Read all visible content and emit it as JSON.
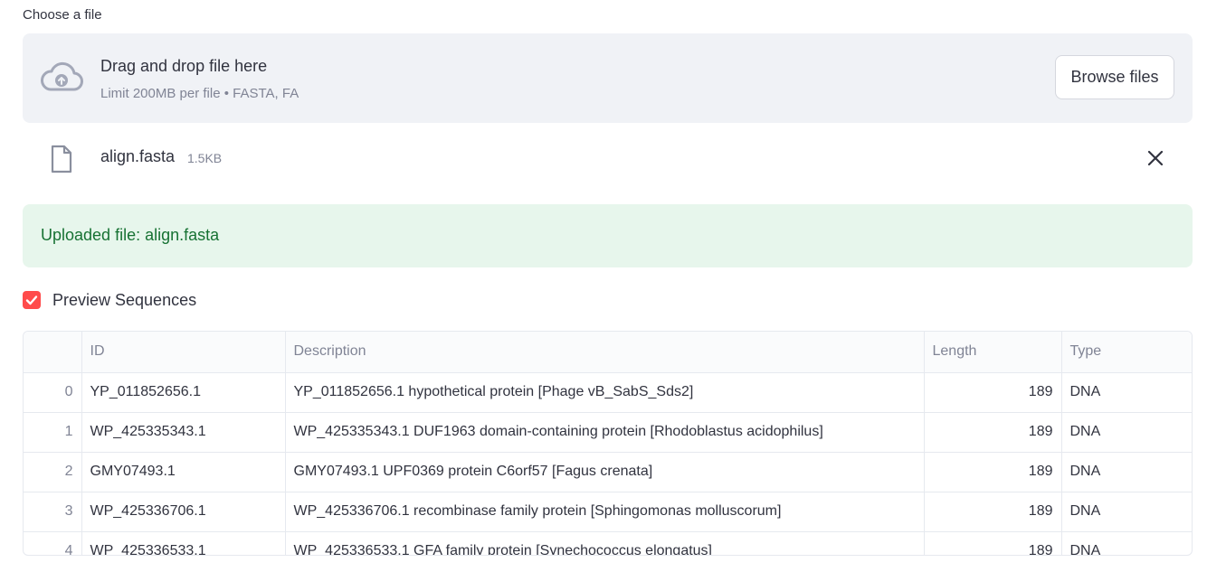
{
  "uploader": {
    "label": "Choose a file",
    "drop_title": "Drag and drop file here",
    "limit_text": "Limit 200MB per file • FASTA, FA",
    "browse_label": "Browse files",
    "cloud_icon": "cloud-upload-icon"
  },
  "file": {
    "name": "align.fasta",
    "size": "1.5KB",
    "file_icon": "file-icon",
    "remove_icon": "close-icon"
  },
  "success": {
    "message": "Uploaded file: align.fasta",
    "color": "#177233",
    "background": "#e7f6ec"
  },
  "preview": {
    "label": "Preview Sequences",
    "checked": true,
    "accent": "#ff4b4b"
  },
  "table": {
    "columns": [
      "",
      "ID",
      "Description",
      "Length",
      "Type"
    ],
    "rows": [
      {
        "index": "0",
        "id": "YP_011852656.1",
        "description": "YP_011852656.1 hypothetical protein [Phage vB_SabS_Sds2]",
        "length": "189",
        "type": "DNA"
      },
      {
        "index": "1",
        "id": "WP_425335343.1",
        "description": "WP_425335343.1 DUF1963 domain-containing protein [Rhodoblastus acidophilus]",
        "length": "189",
        "type": "DNA"
      },
      {
        "index": "2",
        "id": "GMY07493.1",
        "description": "GMY07493.1 UPF0369 protein C6orf57 [Fagus crenata]",
        "length": "189",
        "type": "DNA"
      },
      {
        "index": "3",
        "id": "WP_425336706.1",
        "description": "WP_425336706.1 recombinase family protein [Sphingomonas molluscorum]",
        "length": "189",
        "type": "DNA"
      },
      {
        "index": "4",
        "id": "WP_425336533.1",
        "description": "WP_425336533.1 GFA family protein [Synechococcus elongatus]",
        "length": "189",
        "type": "DNA"
      }
    ]
  }
}
